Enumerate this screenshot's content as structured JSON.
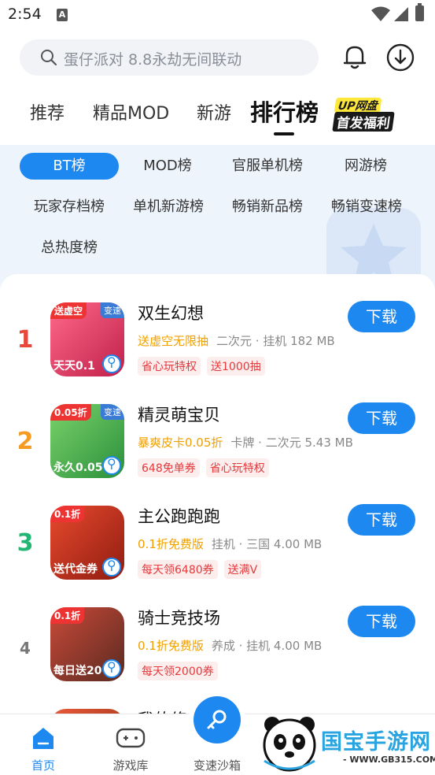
{
  "status_bar": {
    "time": "2:54"
  },
  "search": {
    "placeholder": "蛋仔派对 8.8永劫无间联动"
  },
  "tabs": [
    {
      "label": "推荐"
    },
    {
      "label": "精品MOD"
    },
    {
      "label": "新游"
    },
    {
      "label": "排行榜",
      "active": true
    }
  ],
  "promo": {
    "line1": "UP网盘",
    "line2": "首发福利"
  },
  "chips": [
    {
      "label": "BT榜",
      "active": true
    },
    {
      "label": "MOD榜"
    },
    {
      "label": "官服单机榜"
    },
    {
      "label": "网游榜"
    },
    {
      "label": "玩家存档榜"
    },
    {
      "label": "单机新游榜"
    },
    {
      "label": "畅销新品榜"
    },
    {
      "label": "畅销变速榜"
    },
    {
      "label": "总热度榜"
    }
  ],
  "download_label": "下载",
  "apps": [
    {
      "rank": "1",
      "rank_color": "#e8483b",
      "name": "双生幻想",
      "highlight": "送虚空无限抽",
      "info": "二次元 · 挂机  182 MB",
      "tags": [
        "省心玩特权",
        "送1000抽"
      ],
      "icon": {
        "top_left": "送虚空",
        "top_right": "变速",
        "bottom": "天天0.1",
        "colors": [
          "#ff6a8a",
          "#c0204a"
        ]
      }
    },
    {
      "rank": "2",
      "rank_color": "#f59a23",
      "name": "精灵萌宝贝",
      "highlight": "暴爽皮卡0.05折",
      "info": "卡牌 · 二次元  5.43 MB",
      "tags": [
        "648免单券",
        "省心玩特权"
      ],
      "icon": {
        "top_left": "0.05折",
        "top_right": "变速",
        "bottom": "永久0.05",
        "colors": [
          "#7bd36a",
          "#2a8f3c"
        ]
      }
    },
    {
      "rank": "3",
      "rank_color": "#22b573",
      "name": "主公跑跑跑",
      "highlight": "0.1折免费版",
      "info": "挂机 · 三国  4.00 MB",
      "tags": [
        "每天领6480券",
        "送满V"
      ],
      "icon": {
        "top_left": "0.1折",
        "top_right": "",
        "bottom": "送代金券",
        "colors": [
          "#e84a2e",
          "#8f1c10"
        ]
      }
    },
    {
      "rank": "4",
      "rank_color": "#777777",
      "name": "骑士竞技场",
      "highlight": "0.1折免费版",
      "info": "养成 · 挂机  4.00 MB",
      "tags": [
        "每天领2000券"
      ],
      "icon": {
        "top_left": "0.1折",
        "top_right": "",
        "bottom": "每日送20",
        "colors": [
          "#c94a3a",
          "#5a2a20"
        ]
      }
    },
    {
      "rank": "",
      "rank_color": "#777777",
      "name": "我的修仙",
      "highlight": "",
      "info": "",
      "tags": [],
      "icon": {
        "top_left": "",
        "top_right": "",
        "bottom": "",
        "colors": [
          "#e85a3a",
          "#8f2c10"
        ]
      }
    }
  ],
  "bottom_nav": [
    {
      "label": "首页",
      "active": true
    },
    {
      "label": "游戏库"
    },
    {
      "label": "变速沙箱"
    }
  ],
  "watermark": {
    "text": "国宝手游网",
    "url": "- WWW.GB315.COM -"
  },
  "colors": {
    "accent": "#1c88f0",
    "highlight": "#f0a000",
    "tag_red": "#e4393c"
  }
}
